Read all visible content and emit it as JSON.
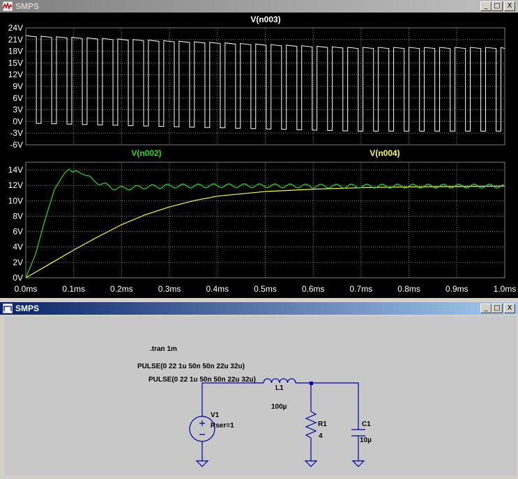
{
  "plot_window": {
    "title": "SMPS"
  },
  "schematic_window": {
    "title": "SMPS"
  },
  "window_buttons": {
    "minimize": "_",
    "maximize": "□",
    "close": "X"
  },
  "chart_data": [
    {
      "type": "line",
      "title": "V(n003)",
      "xlim": [
        0,
        1.0
      ],
      "ylim": [
        -6,
        24
      ],
      "yticks": [
        "24V",
        "21V",
        "18V",
        "15V",
        "12V",
        "9V",
        "6V",
        "3V",
        "0V",
        "-3V",
        "-6V"
      ],
      "grid": true,
      "series": [
        {
          "name": "V(n003)",
          "color": "#ffffff",
          "description_values": {
            "high_start": 22,
            "high_end": 19,
            "low_start": -0.5,
            "low_end": -2.5,
            "period_ms": 0.032,
            "duty": 0.6875
          }
        }
      ]
    },
    {
      "type": "line",
      "xlim": [
        0,
        1.0
      ],
      "ylim": [
        0,
        15
      ],
      "yticks": [
        "14V",
        "12V",
        "10V",
        "8V",
        "6V",
        "4V",
        "2V",
        "0V"
      ],
      "xticks": [
        "0.0ms",
        "0.1ms",
        "0.2ms",
        "0.3ms",
        "0.4ms",
        "0.5ms",
        "0.6ms",
        "0.7ms",
        "0.8ms",
        "0.9ms",
        "1.0ms"
      ],
      "grid": true,
      "series": [
        {
          "name": "V(n002)",
          "color": "#22dd22",
          "x": [
            0,
            0.02,
            0.04,
            0.06,
            0.08,
            0.09,
            0.1,
            0.12,
            0.14,
            0.16,
            0.18,
            0.2,
            0.25,
            0.3,
            0.4,
            0.5,
            0.6,
            0.7,
            0.8,
            0.9,
            1.0
          ],
          "y": [
            0,
            3,
            7.5,
            11.5,
            13.5,
            14.1,
            13.6,
            13.7,
            12.6,
            12.2,
            11.7,
            11.6,
            11.8,
            11.9,
            11.95,
            11.95,
            11.9,
            11.9,
            11.9,
            11.9,
            11.9
          ]
        },
        {
          "name": "V(n004)",
          "color": "#ffff33",
          "x": [
            0,
            0.05,
            0.1,
            0.15,
            0.2,
            0.25,
            0.3,
            0.35,
            0.4,
            0.5,
            0.6,
            0.7,
            0.8,
            0.9,
            1.0
          ],
          "y": [
            0,
            1.8,
            3.6,
            5.3,
            6.9,
            8.2,
            9.2,
            10.0,
            10.6,
            11.2,
            11.5,
            11.7,
            11.8,
            11.85,
            11.9
          ]
        }
      ]
    }
  ],
  "schematic": {
    "directive": ".tran 1m",
    "pulse_line_1": "PULSE(0 22 1u 50n 50n 22u 32u)",
    "pulse_line_2": "PULSE(0 22 1u 50n 50n 22u 32u)",
    "L1_name": "L1",
    "L1_value": "100µ",
    "V1_name": "V1",
    "V1_param": "Rser=1",
    "R1_name": "R1",
    "R1_value": "4",
    "C1_name": "C1",
    "C1_value": "10µ"
  }
}
